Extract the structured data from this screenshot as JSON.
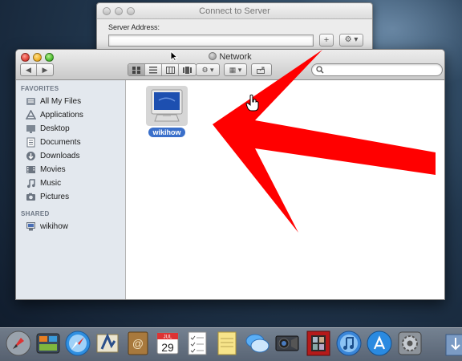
{
  "connect_to_server": {
    "title": "Connect to Server",
    "server_address_label": "Server Address:",
    "server_address_value": "",
    "add_label": "+",
    "options_label": "⚙ ▾"
  },
  "finder": {
    "title": "Network",
    "nav_back": "◀",
    "nav_forward": "▶",
    "search_value": "",
    "sidebar": {
      "favorites_header": "FAVORITES",
      "favorites": [
        {
          "label": "All My Files",
          "icon": "all-files-icon"
        },
        {
          "label": "Applications",
          "icon": "applications-icon"
        },
        {
          "label": "Desktop",
          "icon": "desktop-icon"
        },
        {
          "label": "Documents",
          "icon": "documents-icon"
        },
        {
          "label": "Downloads",
          "icon": "downloads-icon"
        },
        {
          "label": "Movies",
          "icon": "movies-icon"
        },
        {
          "label": "Music",
          "icon": "music-icon"
        },
        {
          "label": "Pictures",
          "icon": "pictures-icon"
        }
      ],
      "shared_header": "SHARED",
      "shared": [
        {
          "label": "wikihow",
          "icon": "computer-icon"
        }
      ]
    },
    "content": {
      "items": [
        {
          "label": "wikihow",
          "icon": "computer-icon",
          "selected": true
        }
      ]
    }
  },
  "dock": {
    "calendar_day": "29",
    "calendar_month": "JUL"
  },
  "colors": {
    "arrow": "#ff0000",
    "selection": "#3a6fca"
  }
}
